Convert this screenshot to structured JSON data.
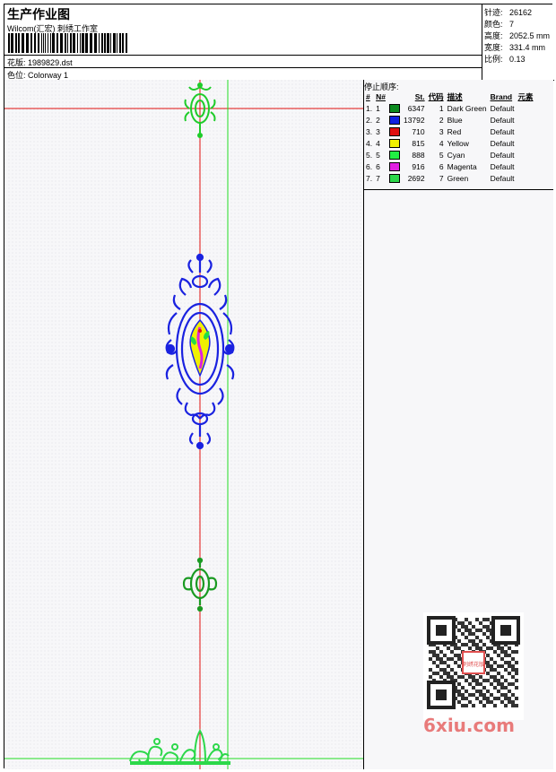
{
  "header": {
    "title": "生产作业图",
    "company": "Wilcom(汇宏) 刺绣工作室",
    "design_label": "花版:",
    "design_value": "1989829.dst",
    "colorway_label": "色位:",
    "colorway_value": "Colorway 1"
  },
  "stats": [
    {
      "label": "针迹:",
      "value": "26162"
    },
    {
      "label": "颜色:",
      "value": "7"
    },
    {
      "label": "高度:",
      "value": "2052.5 mm"
    },
    {
      "label": "宽度:",
      "value": "331.4 mm"
    },
    {
      "label": "比例:",
      "value": "0.13"
    }
  ],
  "stop_sequence": {
    "title": "停止顺序:",
    "headers": [
      "#",
      "N#",
      "St.",
      "代码",
      "描述",
      "Brand",
      "元素"
    ],
    "rows": [
      {
        "num": "1.",
        "n": "1",
        "color": "#0b8a1e",
        "stitches": "6347",
        "code": "1",
        "desc": "Dark Green",
        "brand": "Default"
      },
      {
        "num": "2.",
        "n": "2",
        "color": "#1020e0",
        "stitches": "13792",
        "code": "2",
        "desc": "Blue",
        "brand": "Default"
      },
      {
        "num": "3.",
        "n": "3",
        "color": "#e01010",
        "stitches": "710",
        "code": "3",
        "desc": "Red",
        "brand": "Default"
      },
      {
        "num": "4.",
        "n": "4",
        "color": "#f0f000",
        "stitches": "815",
        "code": "4",
        "desc": "Yellow",
        "brand": "Default"
      },
      {
        "num": "5.",
        "n": "5",
        "color": "#22ee44",
        "stitches": "888",
        "code": "5",
        "desc": "Cyan",
        "brand": "Default"
      },
      {
        "num": "6.",
        "n": "6",
        "color": "#e020e0",
        "stitches": "916",
        "code": "6",
        "desc": "Magenta",
        "brand": "Default"
      },
      {
        "num": "7.",
        "n": "7",
        "color": "#2cd84a",
        "stitches": "2692",
        "code": "7",
        "desc": "Green",
        "brand": "Default"
      }
    ]
  },
  "watermark": "6xiu.com",
  "qr_badge": "刺绣花版",
  "colors": {
    "guide_red": "#e01010",
    "guide_green": "#22dd22",
    "blue_motif": "#1a22e0",
    "green_motif": "#1a9a22"
  }
}
